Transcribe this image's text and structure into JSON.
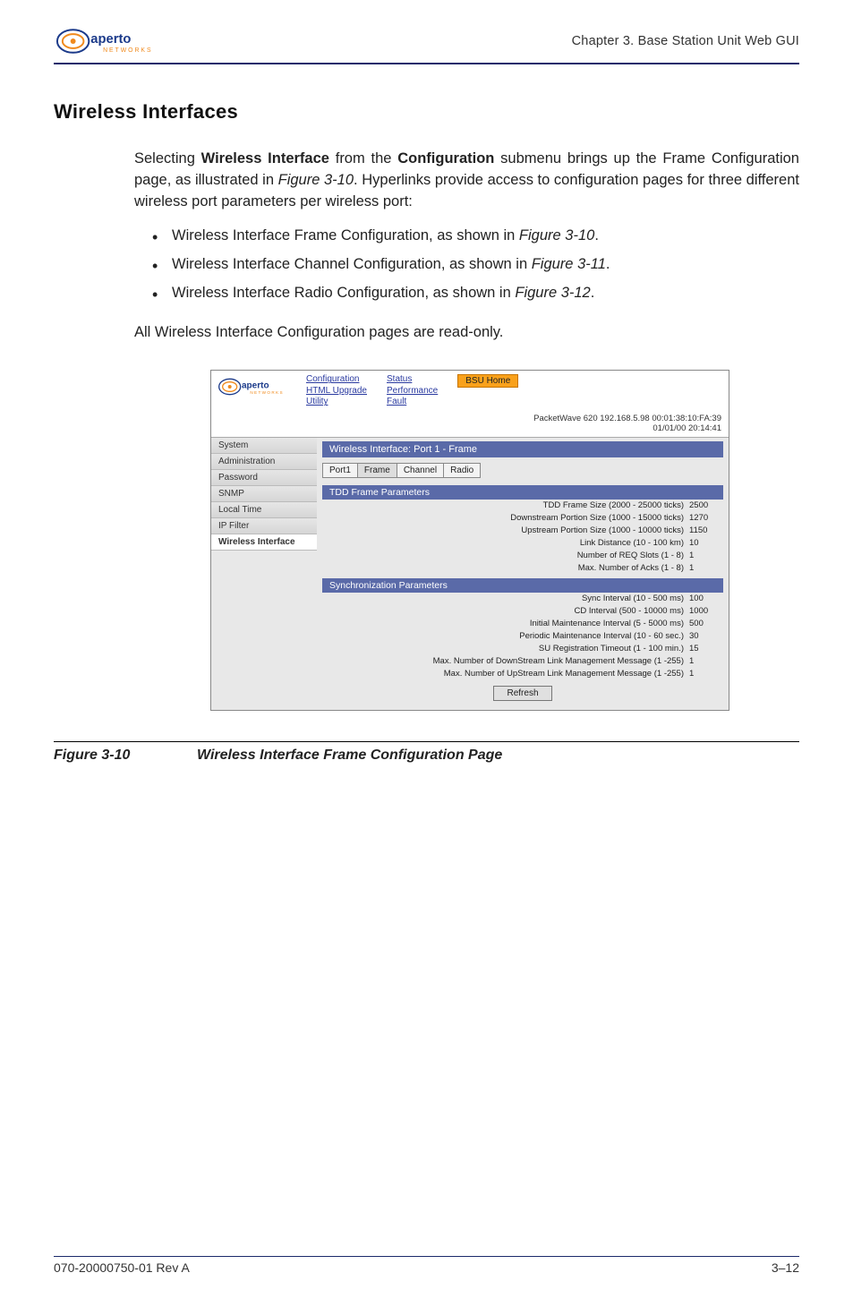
{
  "header": {
    "chapter": "Chapter 3.  Base Station Unit Web GUI"
  },
  "section": {
    "title": "Wireless Interfaces",
    "para1_a": "Selecting ",
    "para1_b": "Wireless Interface",
    "para1_c": " from the ",
    "para1_d": "Configuration",
    "para1_e": " submenu brings up the Frame Configuration page, as illustrated in ",
    "para1_f": "Figure 3-10",
    "para1_g": ". Hyperlinks provide access to configuration pages for three different wireless port parameters per wireless port:",
    "bullets": [
      {
        "pre": "Wireless Interface Frame Configuration, as shown in ",
        "fig": "Figure 3-10",
        "post": "."
      },
      {
        "pre": "Wireless Interface Channel Configuration, as shown in ",
        "fig": "Figure 3-11",
        "post": "."
      },
      {
        "pre": "Wireless Interface Radio Configuration, as shown in ",
        "fig": "Figure 3-12",
        "post": "."
      }
    ],
    "para2": "All Wireless Interface Configuration pages are read-only."
  },
  "figure": {
    "number": "Figure 3-10",
    "caption": "Wireless Interface Frame Configuration Page",
    "nav_col1": [
      "Configuration",
      "HTML Upgrade",
      "Utility"
    ],
    "nav_col2": [
      "Status",
      "Performance",
      "Fault"
    ],
    "bsu_home": "BSU Home",
    "info_line1": "PacketWave 620     192.168.5.98     00:01:38:10:FA:39",
    "info_line2": "01/01/00    20:14:41",
    "sidebar": [
      "System",
      "Administration",
      "Password",
      "SNMP",
      "Local Time",
      "IP Filter",
      "Wireless Interface"
    ],
    "sidebar_active_index": 6,
    "title_bar": "Wireless Interface: Port 1 - Frame",
    "tabs": [
      "Port1",
      "Frame",
      "Channel",
      "Radio"
    ],
    "section1_header": "TDD Frame Parameters",
    "section1_rows": [
      {
        "label": "TDD Frame Size (2000 - 25000 ticks)",
        "value": "2500"
      },
      {
        "label": "Downstream Portion Size (1000 - 15000 ticks)",
        "value": "1270"
      },
      {
        "label": "Upstream Portion Size (1000 - 10000 ticks)",
        "value": "1150"
      },
      {
        "label": "Link Distance (10 - 100 km)",
        "value": "10"
      },
      {
        "label": "Number of REQ Slots (1 - 8)",
        "value": "1"
      },
      {
        "label": "Max. Number of Acks (1 - 8)",
        "value": "1"
      }
    ],
    "section2_header": "Synchronization Parameters",
    "section2_rows": [
      {
        "label": "Sync Interval (10 - 500 ms)",
        "value": "100"
      },
      {
        "label": "CD Interval (500 - 10000 ms)",
        "value": "1000"
      },
      {
        "label": "Initial Maintenance Interval (5 - 5000 ms)",
        "value": "500"
      },
      {
        "label": "Periodic Maintenance Interval (10 - 60 sec.)",
        "value": "30"
      },
      {
        "label": "SU Registration Timeout (1 - 100 min.)",
        "value": "15"
      },
      {
        "label": "Max. Number of DownStream Link Management Message (1 -255)",
        "value": "1"
      },
      {
        "label": "Max. Number of UpStream Link Management Message (1 -255)",
        "value": "1"
      }
    ],
    "refresh": "Refresh"
  },
  "footer": {
    "left": "070-20000750-01 Rev A",
    "right": "3–12"
  }
}
